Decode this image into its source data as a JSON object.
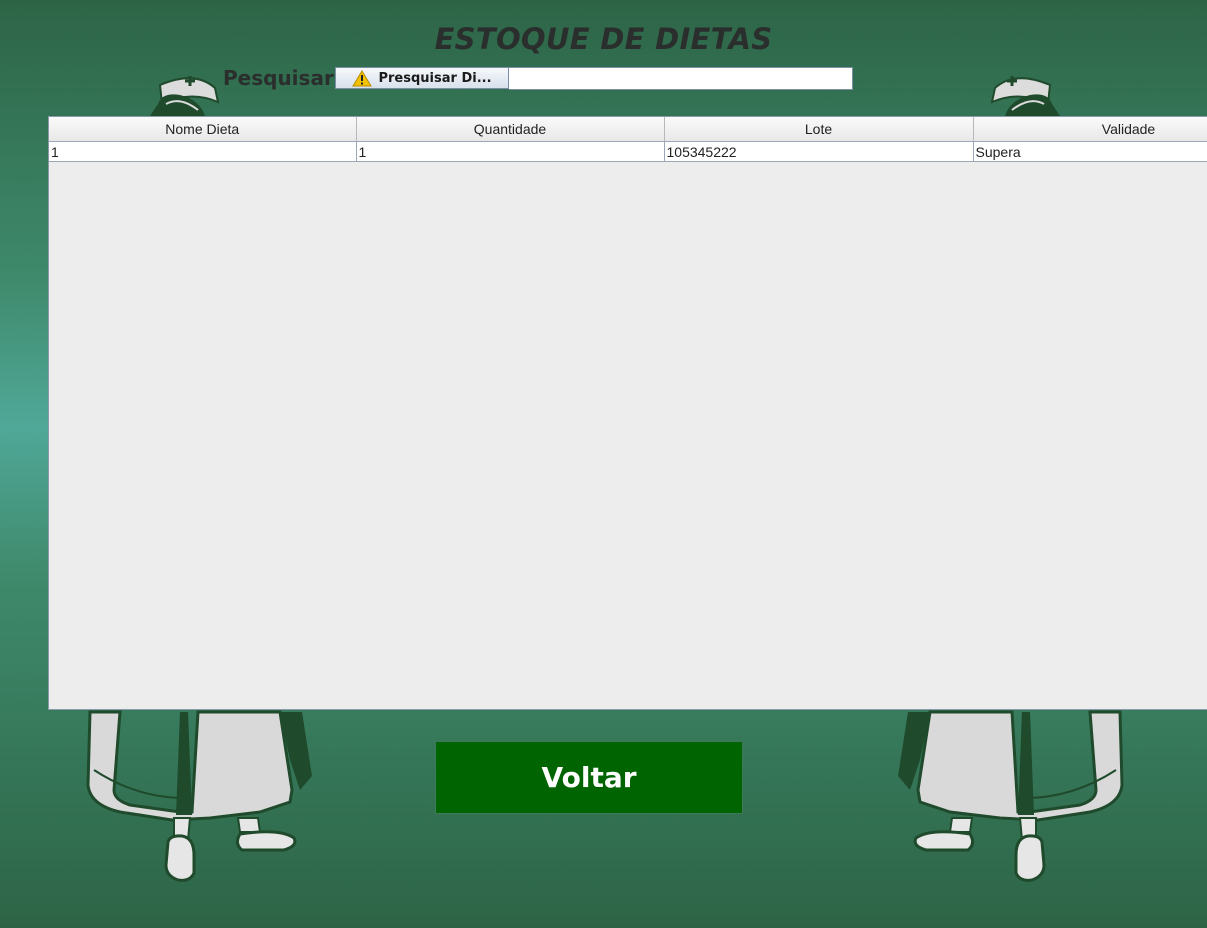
{
  "header": {
    "title": "ESTOQUE DE DIETAS"
  },
  "search": {
    "label": "Pesquisar:",
    "button_label": "Presquisar Di...",
    "button_icon": "warning-icon",
    "input_value": ""
  },
  "table": {
    "columns": [
      "Nome Dieta",
      "Quantidade",
      "Lote",
      "Validade"
    ],
    "rows": [
      [
        "1",
        "1",
        "105345222",
        "Supera"
      ]
    ]
  },
  "footer": {
    "back_label": "Voltar"
  },
  "colors": {
    "background": "#3f8a6c",
    "button_green": "#006400",
    "title_text": "#2a2e2c",
    "nurse_dark": "#1f4a2c",
    "nurse_light": "#d9d9d9"
  }
}
